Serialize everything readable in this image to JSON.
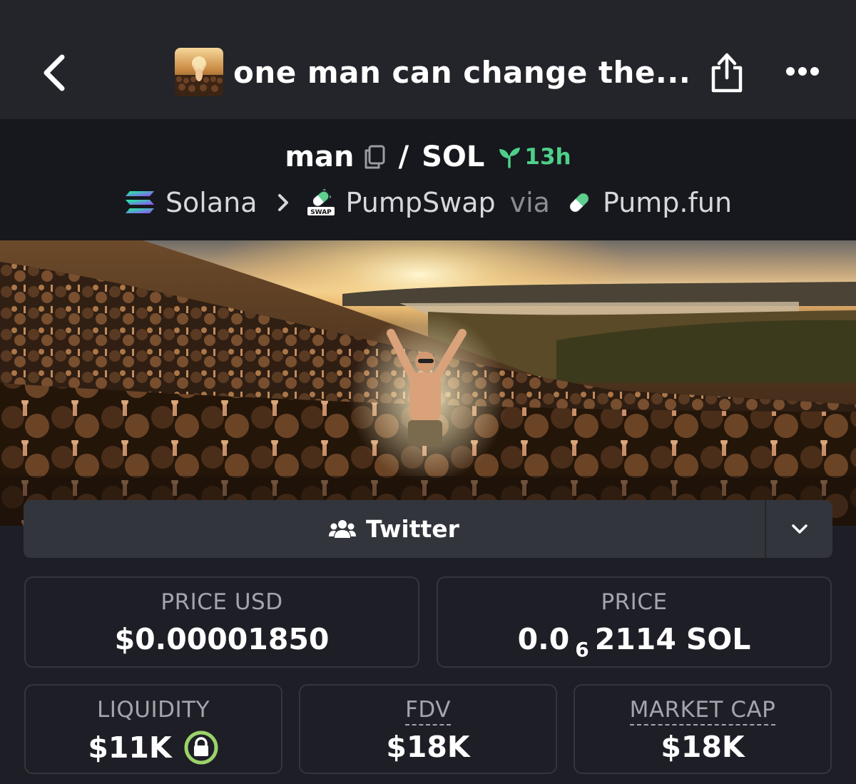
{
  "header": {
    "title": "one man can change the...",
    "back_icon": "chevron-left-icon",
    "share_icon": "share-icon",
    "more_icon": "more-icon"
  },
  "pair": {
    "base": "man",
    "separator": "/",
    "quote": "SOL",
    "age": "13h",
    "age_color": "#4ed08a"
  },
  "chain": {
    "network": "Solana",
    "dex": "PumpSwap",
    "via_label": "via",
    "launchpad": "Pump.fun"
  },
  "social": {
    "twitter_label": "Twitter"
  },
  "stats": {
    "price_usd": {
      "label": "PRICE USD",
      "value": "$0.00001850"
    },
    "price_native": {
      "label": "PRICE",
      "prefix": "0.0",
      "zeros": "6",
      "digits": "2114",
      "unit": "SOL"
    },
    "liquidity": {
      "label": "LIQUIDITY",
      "value": "$11K"
    },
    "fdv": {
      "label": "FDV",
      "value": "$18K"
    },
    "market_cap": {
      "label": "MARKET CAP",
      "value": "$18K"
    }
  },
  "colors": {
    "background": "#1e1f26",
    "header_bg": "#24252b",
    "pair_bar_bg": "#17181d",
    "accent_green": "#4ed08a",
    "lock_ring": "#9bd36a"
  }
}
